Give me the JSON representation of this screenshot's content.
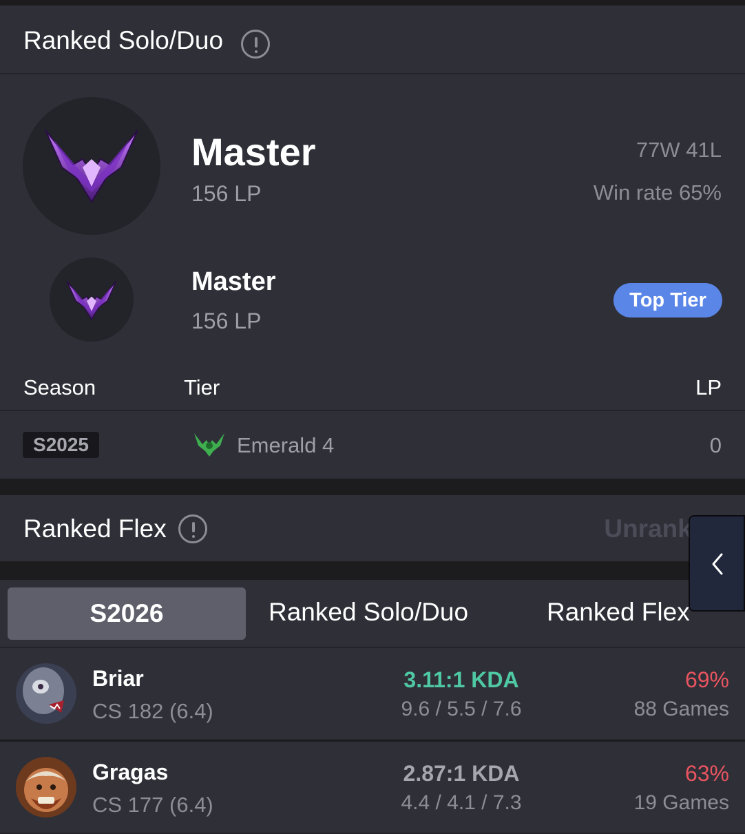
{
  "ranked_solo": {
    "title": "Ranked Solo/Duo",
    "tier": "Master",
    "lp": "156 LP",
    "record": "77W 41L",
    "win_rate": "Win rate 65%",
    "peak_tier": "Master",
    "peak_lp": "156 LP",
    "peak_badge": "Top Tier",
    "table_headers": {
      "season": "Season",
      "tier": "Tier",
      "lp": "LP"
    },
    "history": [
      {
        "season": "S2025",
        "tier": "Emerald 4",
        "lp": "0"
      }
    ]
  },
  "ranked_flex": {
    "title": "Ranked Flex",
    "status": "Unranked"
  },
  "tabs": [
    {
      "label": "S2026",
      "active": true
    },
    {
      "label": "Ranked Solo/Duo",
      "active": false
    },
    {
      "label": "Ranked Flex",
      "active": false
    }
  ],
  "champions": [
    {
      "name": "Briar",
      "cs": "CS 182 (6.4)",
      "kda": "3.11:1 KDA",
      "kda_color": "#4fc9a3",
      "kda_detail": "9.6 / 5.5 / 7.6",
      "win_rate": "69%",
      "games": "88 Games"
    },
    {
      "name": "Gragas",
      "cs": "CS 177 (6.4)",
      "kda": "2.87:1 KDA",
      "kda_color": "#a6a6ae",
      "kda_detail": "4.4 / 4.1 / 7.3",
      "win_rate": "63%",
      "games": "19 Games"
    }
  ],
  "colors": {
    "accent": "#5a86e8",
    "win_rate": "#e8545f",
    "kda_good": "#4fc9a3",
    "emerald": "#3fae4f",
    "master_purple": "#8f3dd6"
  },
  "icons": {
    "info": "info-circle-icon",
    "collapse": "chevron-left-icon",
    "master_emblem": "master-emblem-icon",
    "emerald_emblem": "emerald-emblem-icon"
  }
}
